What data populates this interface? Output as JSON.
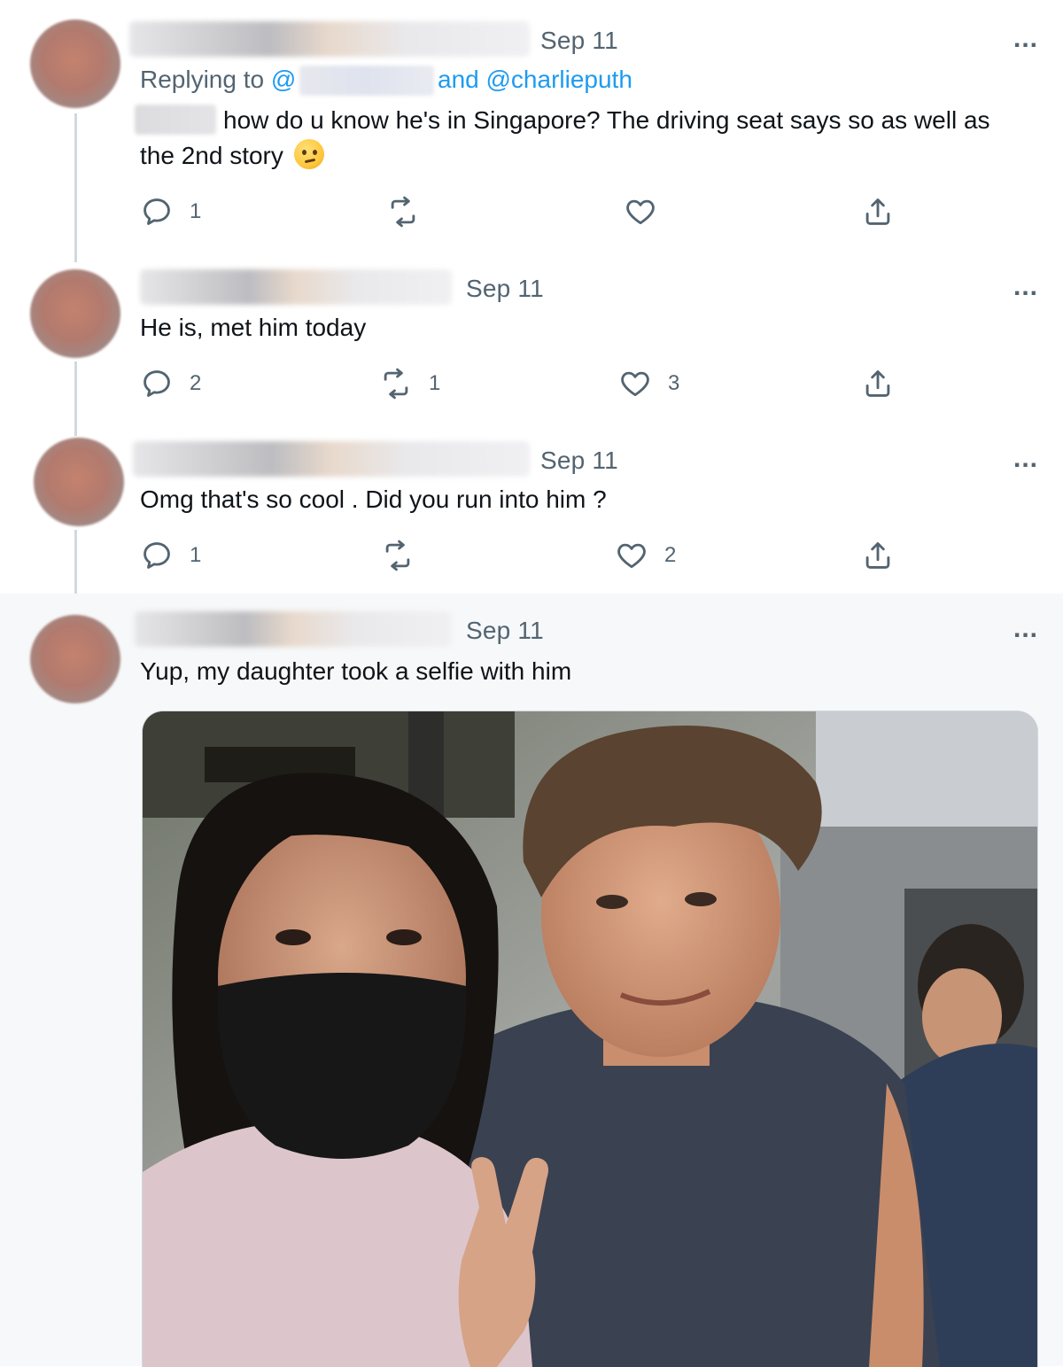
{
  "tweets": [
    {
      "date": "Sep 11",
      "replying_prefix": "Replying to",
      "replying_handle_start": "@",
      "replying_and": "and @charlieputh",
      "text": "how do u know he's in Singapore? The driving seat says so as well as",
      "text_line2": "the 2nd story",
      "emoji_icon": "thinking-face-icon",
      "replies": "1",
      "retweets": "",
      "likes": ""
    },
    {
      "date": "Sep 11",
      "text": "He is, met him today",
      "replies": "2",
      "retweets": "1",
      "likes": "3"
    },
    {
      "date": "Sep 11",
      "text": "Omg that's so cool . Did you run into him ?",
      "replies": "1",
      "retweets": "",
      "likes": "2"
    },
    {
      "date": "Sep 11",
      "text": "Yup, my daughter took a selfie with him"
    }
  ],
  "more_icon": "...",
  "colors": {
    "secondary_text": "#536471",
    "link": "#1d9bf0",
    "line": "#cfd9de",
    "highlight_bg": "#f7f8f9"
  }
}
